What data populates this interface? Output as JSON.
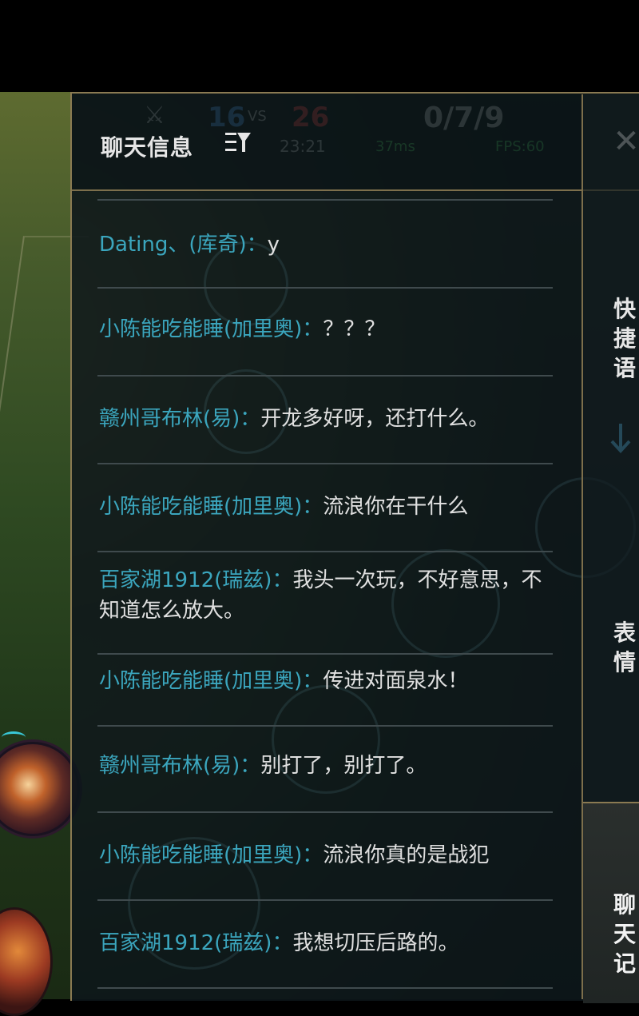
{
  "header": {
    "title": "聊天信息",
    "filter_icon": "filter-icon",
    "close_label": "✕"
  },
  "hud": {
    "team_score_blue": "16",
    "vs": "VS",
    "team_score_red": "26",
    "time": "23:21",
    "kda": "0/7/9",
    "ping": "37ms",
    "fps": "FPS:60"
  },
  "messages": [
    {
      "sender": "Dating、(库奇)",
      "text": "y"
    },
    {
      "sender": "小陈能吃能睡(加里奥)",
      "text": "？？？"
    },
    {
      "sender": "赣州哥布林(易)",
      "text": "开龙多好呀，还打什么。"
    },
    {
      "sender": "小陈能吃能睡(加里奥)",
      "text": "流浪你在干什么"
    },
    {
      "sender": "百家湖1912(瑞兹)",
      "text": "我头一次玩，不好意思，不知道怎么放大。"
    },
    {
      "sender": "小陈能吃能睡(加里奥)",
      "text": "传进对面泉水！"
    },
    {
      "sender": "赣州哥布林(易)",
      "text": "别打了，别打了。"
    },
    {
      "sender": "小陈能吃能睡(加里奥)",
      "text": "流浪你真的是战犯"
    },
    {
      "sender": "百家湖1912(瑞兹)",
      "text": "我想切压后路的。"
    }
  ],
  "colon": "：",
  "side_tabs": {
    "quick_phrases": "快捷语",
    "emotes": "表情",
    "chat_log": "聊天记"
  },
  "colors": {
    "sender": "#3ba6be",
    "text": "#e0e0e0",
    "border_gold": "#8a7a52",
    "panel_bg": "#0d161a"
  }
}
